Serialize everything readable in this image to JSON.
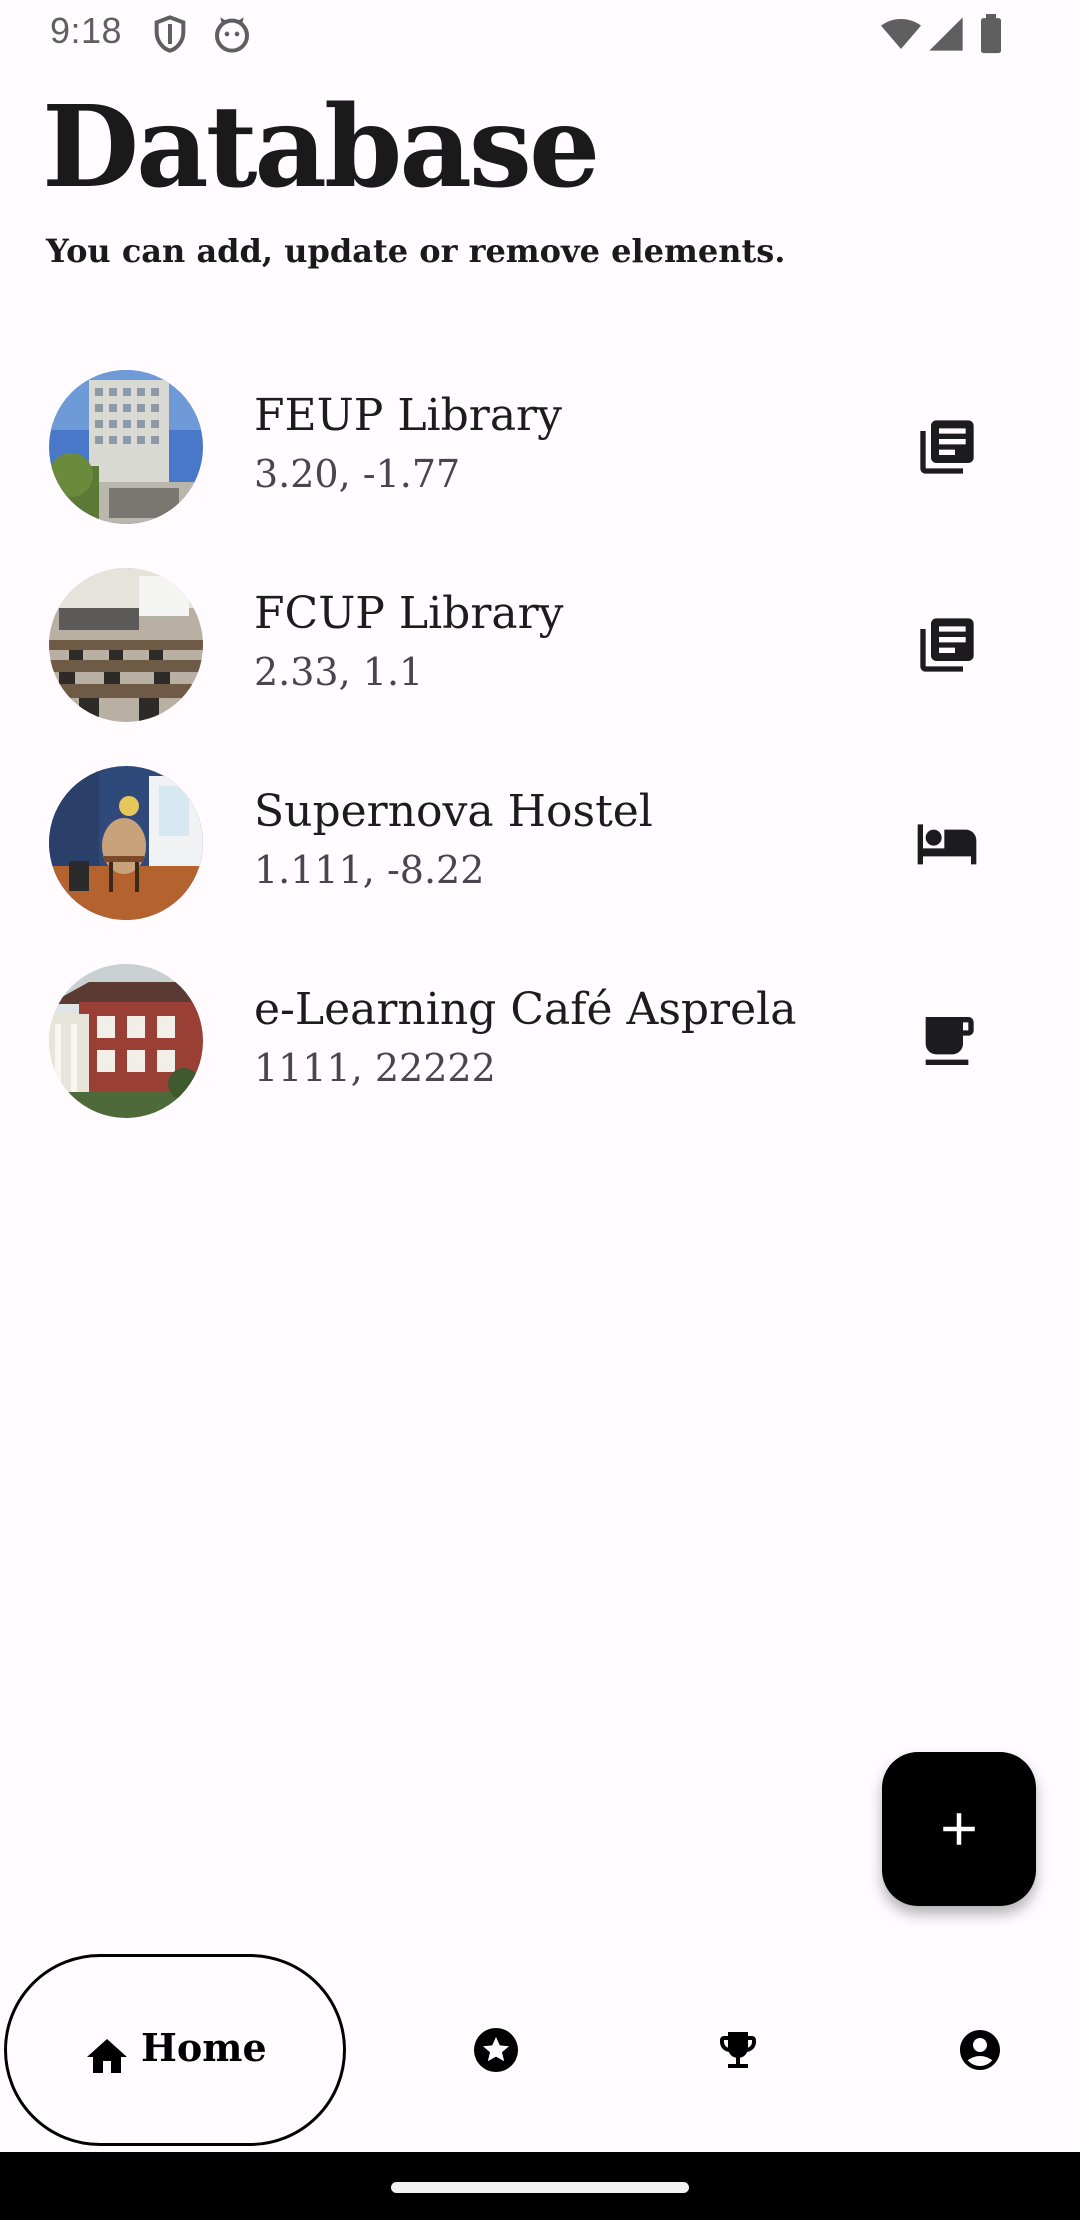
{
  "status_bar": {
    "time": "9:18",
    "icons": [
      "shield-icon",
      "cat-notification-icon",
      "wifi-icon",
      "signal-icon",
      "battery-icon"
    ]
  },
  "header": {
    "title": "Database",
    "subtitle": "You can add, update or remove elements."
  },
  "list": {
    "items": [
      {
        "title": "FEUP Library",
        "coords": "3.20, -1.77",
        "icon": "library-books-icon"
      },
      {
        "title": "FCUP Library",
        "coords": "2.33, 1.1",
        "icon": "library-books-icon"
      },
      {
        "title": "Supernova Hostel",
        "coords": "1.111, -8.22",
        "icon": "bed-icon"
      },
      {
        "title": "e-Learning Café Asprela",
        "coords": "1111, 22222",
        "icon": "coffee-cup-icon"
      }
    ]
  },
  "fab": {
    "icon": "plus-icon"
  },
  "bottom_nav": {
    "home_label": "Home",
    "items": [
      "home-icon",
      "star-badge-icon",
      "trophy-icon",
      "account-circle-icon"
    ]
  },
  "colors": {
    "background": "#fffbfe",
    "text": "#1c1b1f",
    "secondary_text": "#49454f",
    "fab": "#000000"
  }
}
